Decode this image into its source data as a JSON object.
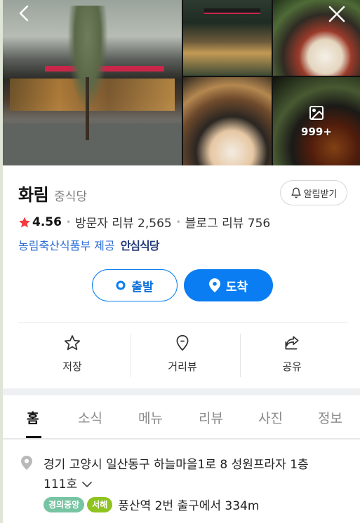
{
  "place": {
    "name": "화림",
    "category": "중식당",
    "notify_label": "알림받기",
    "rating": "4.56",
    "visitor_reviews": "방문자 리뷰 2,565",
    "blog_reviews": "블로그 리뷰 756",
    "source": "농림축산식품부 제공",
    "safe_badge": "안심식당"
  },
  "photos": {
    "more_count": "999+"
  },
  "route": {
    "depart_label": "출발",
    "arrive_label": "도착"
  },
  "actions": [
    {
      "label": "저장",
      "icon": "star-icon"
    },
    {
      "label": "거리뷰",
      "icon": "location-pin-icon"
    },
    {
      "label": "공유",
      "icon": "share-icon"
    }
  ],
  "tabs": [
    {
      "label": "홈",
      "active": true
    },
    {
      "label": "소식"
    },
    {
      "label": "메뉴"
    },
    {
      "label": "리뷰"
    },
    {
      "label": "사진"
    },
    {
      "label": "정보"
    }
  ],
  "info": {
    "address_line1": "경기 고양시 일산동구 하늘마을1로 8 성원프라자 1층",
    "address_line2": "111호",
    "subway_lines": [
      {
        "name": "경의중앙",
        "color": "#77c4a3"
      },
      {
        "name": "서해",
        "color": "#8fc31f"
      }
    ],
    "station_info": "풍산역 2번 출구에서 334m"
  },
  "colors": {
    "accent": "#0a7df2",
    "rating_star": "#f5393f",
    "source_link": "#2c6ed6"
  }
}
